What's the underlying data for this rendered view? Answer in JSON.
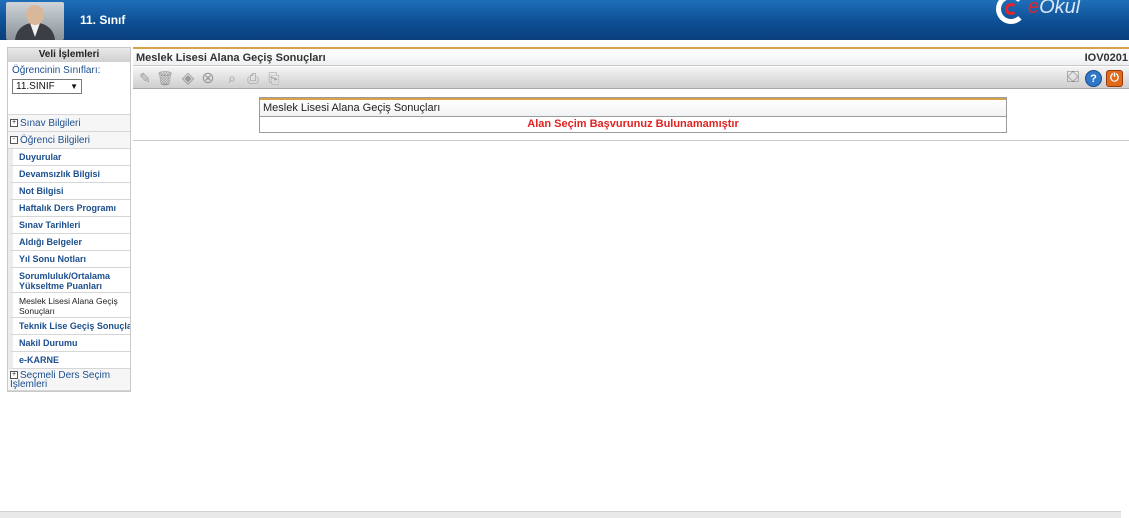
{
  "header": {
    "class_title": "11. Sınıf",
    "logo_text_e": "e",
    "logo_text": "Okul",
    "colors": {
      "banner": "#0d4f95",
      "accent": "#e4242b"
    }
  },
  "sidebar": {
    "heading": "Veli İşlemleri",
    "class_label": "Öğrencinin Sınıfları:",
    "class_select_value": "11.SINIF",
    "groups": [
      {
        "label": "Sınav Bilgileri",
        "toggle": "+"
      },
      {
        "label": "Öğrenci Bilgileri",
        "toggle": "-"
      },
      {
        "label": "Seçmeli Ders Seçim İşlemleri",
        "toggle": "+"
      }
    ],
    "items": [
      {
        "label": "Duyurular"
      },
      {
        "label": "Devamsızlık Bilgisi"
      },
      {
        "label": "Not Bilgisi"
      },
      {
        "label": "Haftalık Ders Programı"
      },
      {
        "label": "Sınav Tarihleri"
      },
      {
        "label": "Aldığı Belgeler"
      },
      {
        "label": "Yıl Sonu Notları"
      },
      {
        "label": "Sorumluluk/Ortalama Yükseltme Puanları"
      },
      {
        "label": "Meslek Lisesi Alana Geçiş Sonuçları"
      },
      {
        "label": "Teknik Lise Geçiş Sonuçları"
      },
      {
        "label": "Nakil Durumu"
      },
      {
        "label": "e-KARNE"
      }
    ]
  },
  "main": {
    "title": "Meslek Lisesi Alana Geçiş Sonuçları",
    "page_code": "IOV0201",
    "result_box": {
      "title": "Meslek Lisesi Alana Geçiş Sonuçları",
      "message": "Alan Seçim Başvurunuz Bulunamamıştır"
    }
  }
}
